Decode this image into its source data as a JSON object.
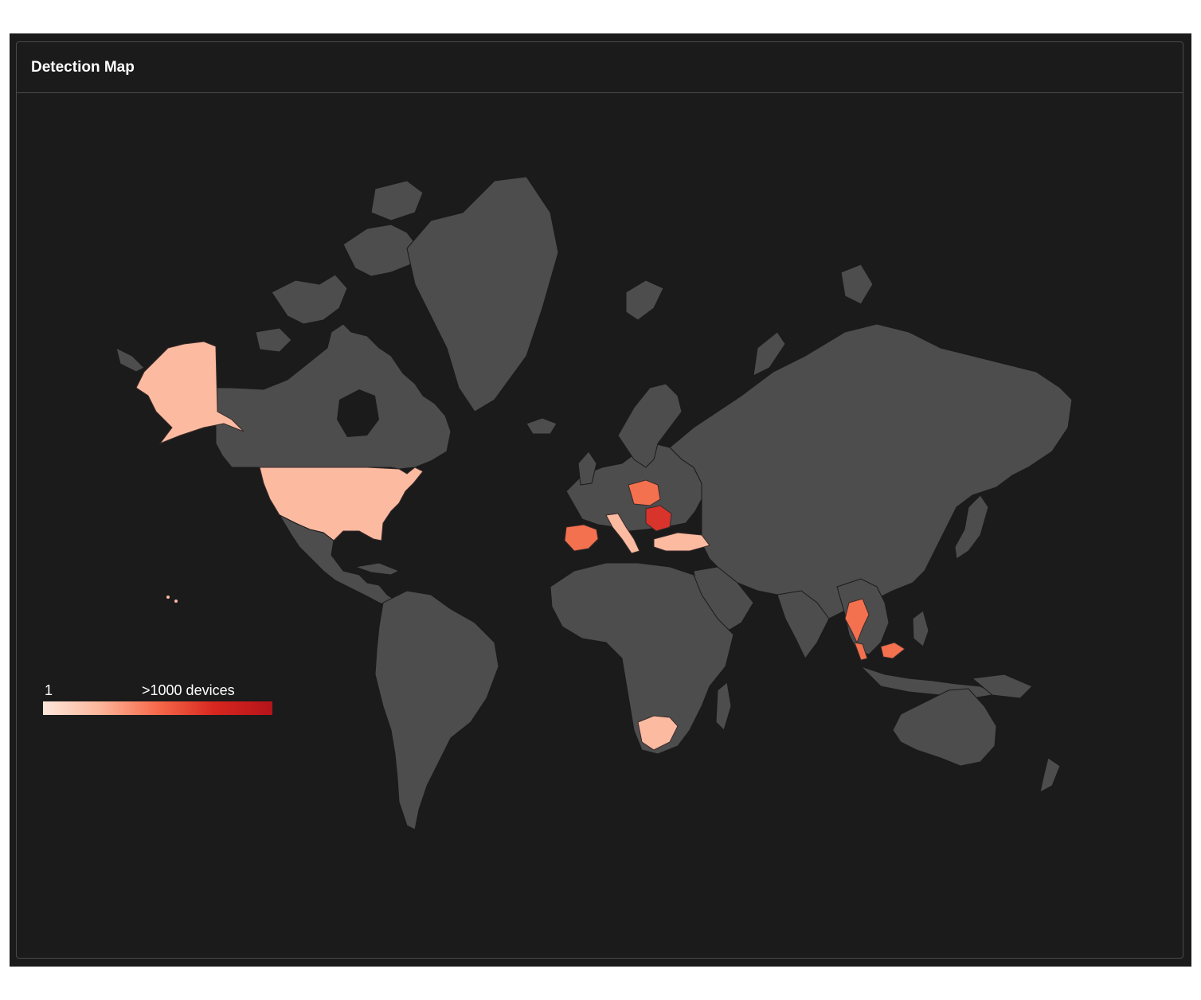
{
  "panel": {
    "title": "Detection Map"
  },
  "legend": {
    "min_label": "1",
    "max_label": ">1000 devices",
    "gradient": [
      "#fde7dc",
      "#fcb59a",
      "#f6694a",
      "#d7261f",
      "#b5141a"
    ]
  },
  "colors": {
    "background": "#1b1b1b",
    "land": "#4d4d4d",
    "border": "#4a4a4a",
    "level_low": "#fcbba1",
    "level_mid": "#f4714f",
    "level_high": "#d8342b"
  },
  "highlighted_countries": [
    {
      "name": "United States",
      "level": "low"
    },
    {
      "name": "Spain",
      "level": "mid"
    },
    {
      "name": "Italy",
      "level": "low"
    },
    {
      "name": "Poland",
      "level": "mid"
    },
    {
      "name": "Romania",
      "level": "high"
    },
    {
      "name": "Turkey",
      "level": "low"
    },
    {
      "name": "South Africa",
      "level": "low"
    },
    {
      "name": "Thailand",
      "level": "mid"
    },
    {
      "name": "Malaysia",
      "level": "mid"
    }
  ]
}
